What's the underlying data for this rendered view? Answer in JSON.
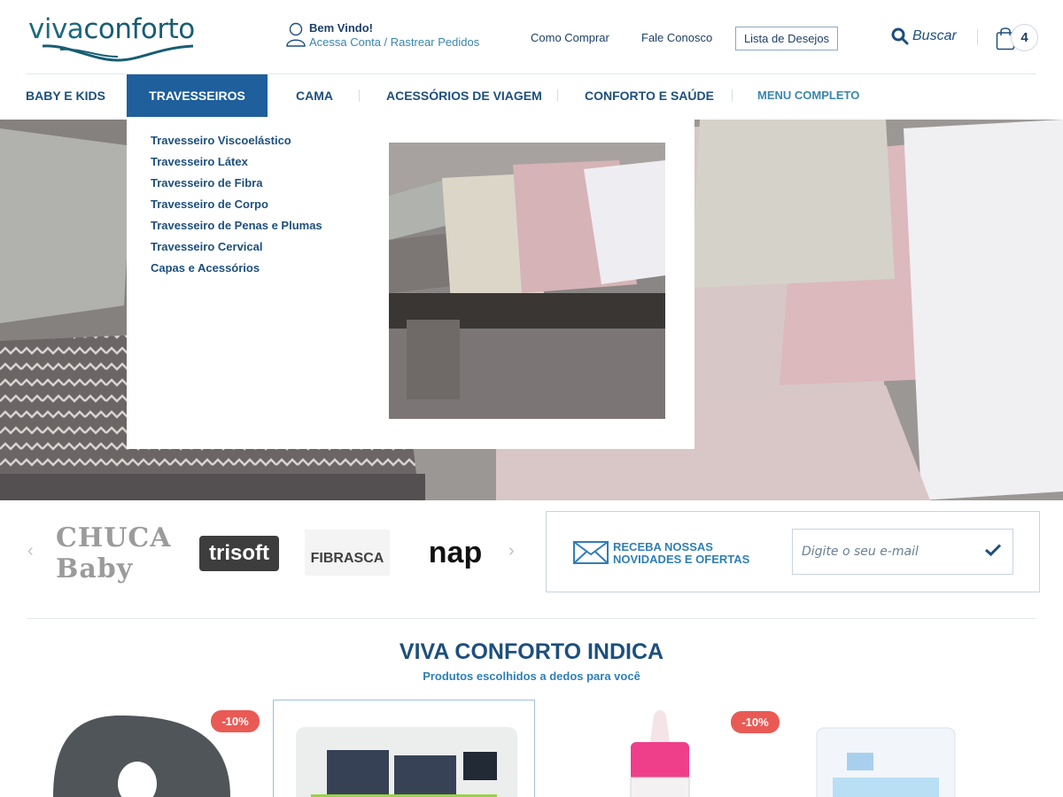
{
  "header": {
    "logo_text_1": "viva",
    "logo_text_2": "conforto",
    "welcome_title": "Bem Vindo!",
    "welcome_link": "Acessa Conta / Rastrear Pedidos",
    "links": [
      "Como Comprar",
      "Fale Conosco"
    ],
    "wishlist": "Lista de Desejos",
    "search_label": "Buscar",
    "cart_count": "4"
  },
  "nav": {
    "items": [
      "Baby e Kids",
      "Travesseiros",
      "Cama",
      "Acessórios de Viagem",
      "Conforto e Saúde",
      "Menu Completo"
    ],
    "active": "Travesseiros"
  },
  "dropdown": {
    "items": [
      "Travesseiro Viscoelástico",
      "Travesseiro Látex",
      "Travesseiro de Fibra",
      "Travesseiro de Corpo",
      "Travesseiro de Penas e Plumas",
      "Travesseiro Cervical",
      "Capas e Acessórios"
    ]
  },
  "brands": [
    "CHUCA Baby",
    "trisoft",
    "FIBRASCA",
    "nap"
  ],
  "newsletter": {
    "title_line1": "Receba nossas",
    "title_line2": "novidades e ofertas",
    "placeholder": "Digite o seu e-mail"
  },
  "section": {
    "title": "VIVA CONFORTO INDICA",
    "subtitle": "Produtos escolhidos a dedos para você"
  },
  "products": [
    {
      "badge": "-10%"
    },
    {
      "badge": ""
    },
    {
      "badge": "-10%"
    },
    {
      "badge": ""
    }
  ],
  "colors": {
    "brand_blue": "#1d4f7c",
    "active_nav": "#1e5f9c",
    "accent": "#3a86ad",
    "discount": "#ea5a55"
  }
}
